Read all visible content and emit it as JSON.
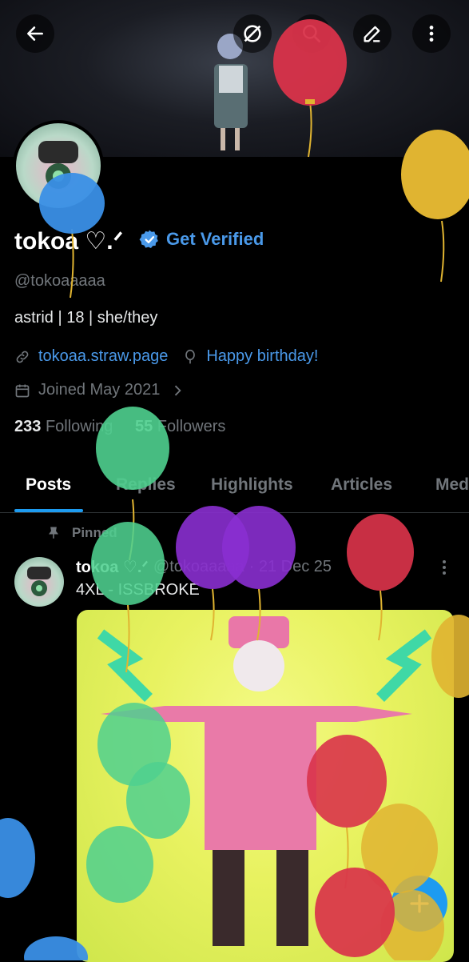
{
  "profile": {
    "display_name": "tokoa ♡.ᐟ",
    "get_verified_label": "Get Verified",
    "handle": "@tokoaaaaa",
    "bio": "astrid | 18 | she/they",
    "website": "tokoaa.straw.page",
    "birthday_label": "Happy birthday!",
    "joined": "Joined May 2021",
    "following_count": "233",
    "following_label": "Following",
    "followers_count": "55",
    "followers_label": "Followers"
  },
  "tabs": [
    "Posts",
    "Replies",
    "Highlights",
    "Articles",
    "Media"
  ],
  "active_tab": "Posts",
  "pinned_post": {
    "pinned_label": "Pinned",
    "author": "tokoa ♡.ᐟ",
    "handle": "@tokoaaaaa",
    "date": "· 21 Dec 25",
    "text": "4XL - ISSBROKE"
  },
  "colors": {
    "accent": "#1d9bf0",
    "link": "#4a99e9",
    "muted": "#71767b",
    "balloon_red": "#d9334a",
    "balloon_yellow": "#e0b431",
    "balloon_blue": "#3a8fe6",
    "balloon_green": "#4fd08f",
    "balloon_purple": "#8a2fd0"
  },
  "icons": {
    "back": "arrow-left-icon",
    "grok": "grok-icon",
    "search": "search-icon",
    "edit": "pencil-icon",
    "more": "more-vertical-icon",
    "link": "link-icon",
    "birthday": "balloon-icon",
    "calendar": "calendar-icon",
    "pin": "pin-icon",
    "compose": "plus-icon"
  }
}
